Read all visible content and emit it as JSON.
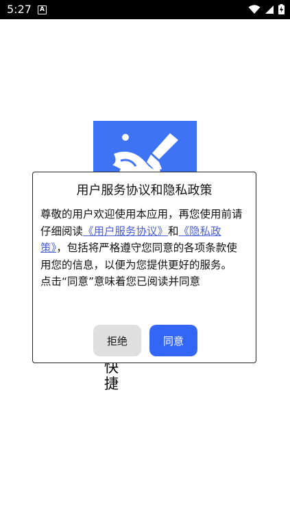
{
  "status_bar": {
    "time": "5:27",
    "notification_icon": "A",
    "icons": [
      "wifi-icon",
      "signal-icon",
      "battery-charging-icon"
    ]
  },
  "background": {
    "app_icon": "broom-icon",
    "partial_text_line1": "快",
    "partial_text_line2": "捷"
  },
  "dialog": {
    "title": "用户服务协议和隐私政策",
    "body": {
      "intro": " 尊敬的用户欢迎使用本应用，再您使用前请仔细阅读",
      "link_service": "《用户服务协议》",
      "and": "和",
      "link_privacy": "《隐私政策》",
      "rest": "，包括将严格遵守您同意的各项条款使用您的信息，以便为您提供更好的服务。",
      "note": "点击“同意”意味着您已阅读并同意"
    },
    "reject_label": "拒绝",
    "agree_label": "同意"
  },
  "colors": {
    "accent": "#3466f5",
    "icon_bg": "#3f73f5",
    "link": "#4a5fd6",
    "reject_bg": "#dfdfdf"
  }
}
